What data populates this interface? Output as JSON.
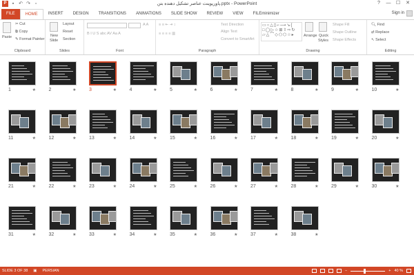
{
  "title_bar": {
    "title": "پاورپوینت عناصر تشکیل دهنده بتن.pptx - PowerPoint",
    "app_logo": "P",
    "qat_icons": [
      "save-icon",
      "undo-icon",
      "redo-icon",
      "start-from-beginning-icon"
    ],
    "controls": [
      "?",
      "—",
      "☐",
      "✕"
    ]
  },
  "ribbon_tabs": [
    "FILE",
    "HOME",
    "INSERT",
    "DESIGN",
    "TRANSITIONS",
    "ANIMATIONS",
    "SLIDE SHOW",
    "REVIEW",
    "VIEW",
    "FILEminimizer"
  ],
  "active_tab": "HOME",
  "sign_in": "Sign in",
  "ribbon": {
    "clipboard": {
      "label": "Clipboard",
      "paste": "Paste",
      "cut": "Cut",
      "copy": "Copy",
      "format_painter": "Format Painter"
    },
    "slides": {
      "label": "Slides",
      "new_slide": "New",
      "new_slide2": "Slide",
      "layout": "Layout",
      "reset": "Reset",
      "section": "Section"
    },
    "font": {
      "label": "Font"
    },
    "paragraph": {
      "label": "Paragraph",
      "text_direction": "Text Direction",
      "align_text": "Align Text",
      "convert_smartart": "Convert to SmartArt"
    },
    "drawing": {
      "label": "Drawing",
      "arrange": "Arrange",
      "quick_styles": "Quick",
      "quick_styles2": "Styles",
      "shape_fill": "Shape Fill",
      "shape_outline": "Shape Outline",
      "shape_effects": "Shape Effects"
    },
    "editing": {
      "label": "Editing",
      "find": "Find",
      "replace": "Replace",
      "select": "Select"
    }
  },
  "slides": {
    "total": 38,
    "selected": 3,
    "numbers": [
      "1",
      "2",
      "3",
      "4",
      "5",
      "6",
      "7",
      "8",
      "9",
      "10",
      "11",
      "12",
      "13",
      "14",
      "15",
      "16",
      "17",
      "18",
      "19",
      "20",
      "21",
      "22",
      "23",
      "24",
      "25",
      "26",
      "27",
      "28",
      "29",
      "30",
      "31",
      "32",
      "33",
      "34",
      "35",
      "36",
      "37",
      "38"
    ],
    "star": "★"
  },
  "status_bar": {
    "slide_indicator": "SLIDE 3 OF 38",
    "language": "PERSIAN",
    "zoom": "40 %",
    "zoom_level": 0.4
  },
  "colors": {
    "accent": "#d24726",
    "slide_background": "#222222"
  }
}
